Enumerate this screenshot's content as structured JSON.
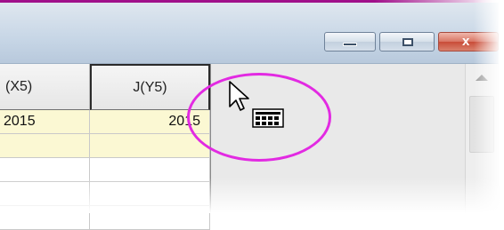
{
  "window": {
    "accent_color": "#a0108a",
    "caption_buttons": [
      {
        "name": "minimize",
        "icon": "minimize-icon"
      },
      {
        "name": "maximize",
        "icon": "maximize-icon"
      },
      {
        "name": "close",
        "icon": "close-icon",
        "glyph": "x"
      }
    ]
  },
  "worksheet": {
    "columns": [
      {
        "header": "(X5)"
      },
      {
        "header": "J(Y5)"
      }
    ],
    "rows": [
      {
        "cells": [
          "2015",
          "2015"
        ],
        "highlight": true
      },
      {
        "cells": [
          "",
          ""
        ],
        "highlight": true
      },
      {
        "cells": [
          "",
          ""
        ],
        "highlight": false
      },
      {
        "cells": [
          "",
          ""
        ],
        "highlight": false
      },
      {
        "cells": [
          "",
          ""
        ],
        "highlight": false
      }
    ],
    "highlight_color": "#fbf8d3"
  },
  "annotation": {
    "ellipse_color": "#e22ae2",
    "cursor_icon": "arrow-cursor-with-worksheet-icon"
  }
}
